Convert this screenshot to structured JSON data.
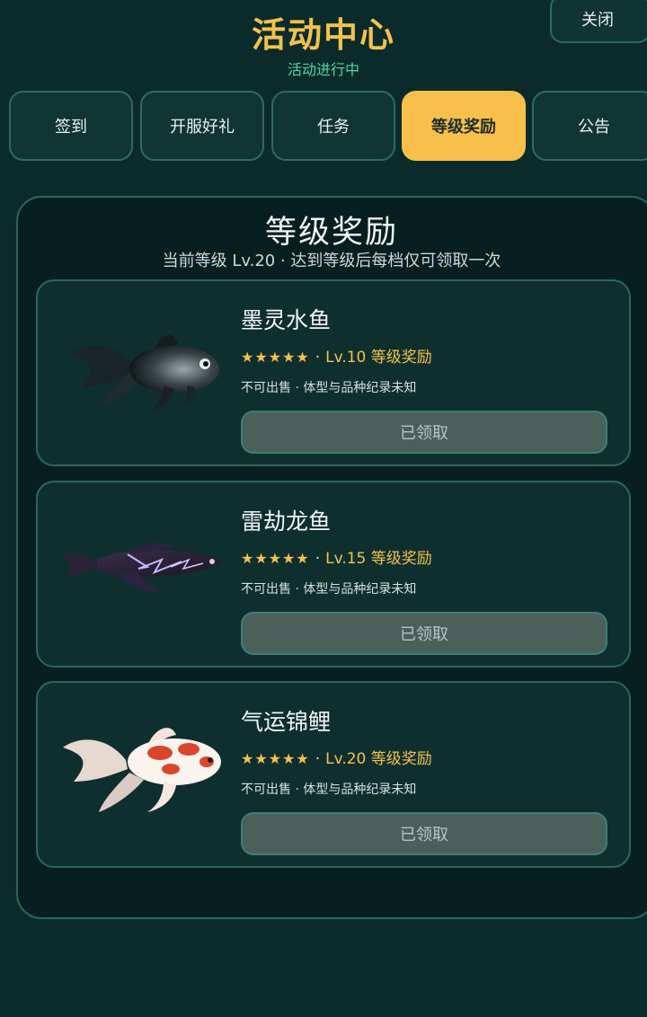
{
  "header": {
    "title": "活动中心",
    "subtitle": "活动进行中",
    "close_label": "关闭"
  },
  "tabs": [
    {
      "label": "签到",
      "active": false
    },
    {
      "label": "开服好礼",
      "active": false
    },
    {
      "label": "任务",
      "active": false
    },
    {
      "label": "等级奖励",
      "active": true
    },
    {
      "label": "公告",
      "active": false
    }
  ],
  "panel": {
    "title": "等级奖励",
    "note": "当前等级 Lv.20 · 达到等级后每档仅可领取一次"
  },
  "rewards": [
    {
      "name": "墨灵水鱼",
      "stars": "★★★★★",
      "level_text": "Lv.10 等级奖励",
      "description": "不可出售 · 体型与品种纪录未知",
      "button_label": "已领取",
      "art_icon": "ink-fish-icon"
    },
    {
      "name": "雷劫龙鱼",
      "stars": "★★★★★",
      "level_text": "Lv.15 等级奖励",
      "description": "不可出售 · 体型与品种纪录未知",
      "button_label": "已领取",
      "art_icon": "thunder-arowana-icon"
    },
    {
      "name": "气运锦鲤",
      "stars": "★★★★★",
      "level_text": "Lv.20 等级奖励",
      "description": "不可出售 · 体型与品种纪录未知",
      "button_label": "已领取",
      "art_icon": "koi-fish-icon"
    }
  ],
  "colors": {
    "background": "#0b2b2b",
    "accent_gold": "#f3c24c",
    "accent_green": "#4fd6a0",
    "card": "#0f2f2f",
    "button_disabled": "#4b5f5b"
  }
}
